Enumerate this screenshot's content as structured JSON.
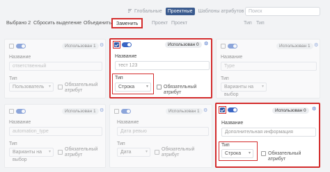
{
  "header": {
    "tabs": [
      "Глобальные",
      "Проектные",
      "Шаблоны атрибутов"
    ],
    "active_tab": "Проектные",
    "search_placeholder": "Поиск"
  },
  "toolbar": {
    "selected": "Выбрано 2",
    "reset": "Сбросить выделение",
    "merge": "Объединить",
    "replace": "Заменить",
    "project_label": "Проект",
    "project_placeholder": "Проект",
    "type_label": "Тип",
    "type_placeholder": "Тип"
  },
  "cards": [
    {
      "used": "Использован 1",
      "name_label": "Название",
      "name_value": "ответственный",
      "type_label": "Тип",
      "type_value": "Пользователь",
      "required": "Обязательный атрибут",
      "checked": false
    },
    {
      "used": "Использован 0",
      "name_label": "Название",
      "name_value": "тест 123",
      "type_label": "Тип",
      "type_value": "Строка",
      "required": "Обязательный атрибут",
      "checked": true
    },
    {
      "used": "Использован 1",
      "name_label": "Название",
      "name_value": "Туре",
      "type_label": "Тип",
      "type_value": "Варианты на выбор",
      "required": "",
      "checked": false
    },
    {
      "used": "Использован 1",
      "name_label": "Название",
      "name_value": "automation_type",
      "type_label": "Тип",
      "type_value": "Варианты на выбор",
      "required": "Обязательный атрибут",
      "checked": false
    },
    {
      "used": "Использован 1",
      "name_label": "Название",
      "name_value": "Дата ревью",
      "type_label": "Тип",
      "type_value": "Дата",
      "required": "Обязательный атрибут",
      "checked": false
    },
    {
      "used": "Использован 0",
      "name_label": "Название",
      "name_value": "Дополнительная информация",
      "type_label": "Тип",
      "type_value": "Строка",
      "required": "Обязательный атрибут",
      "checked": true
    }
  ],
  "colors": {
    "accent": "#3a66c4",
    "highlight": "#d32b2b",
    "active_tab": "#3a5a8e"
  }
}
